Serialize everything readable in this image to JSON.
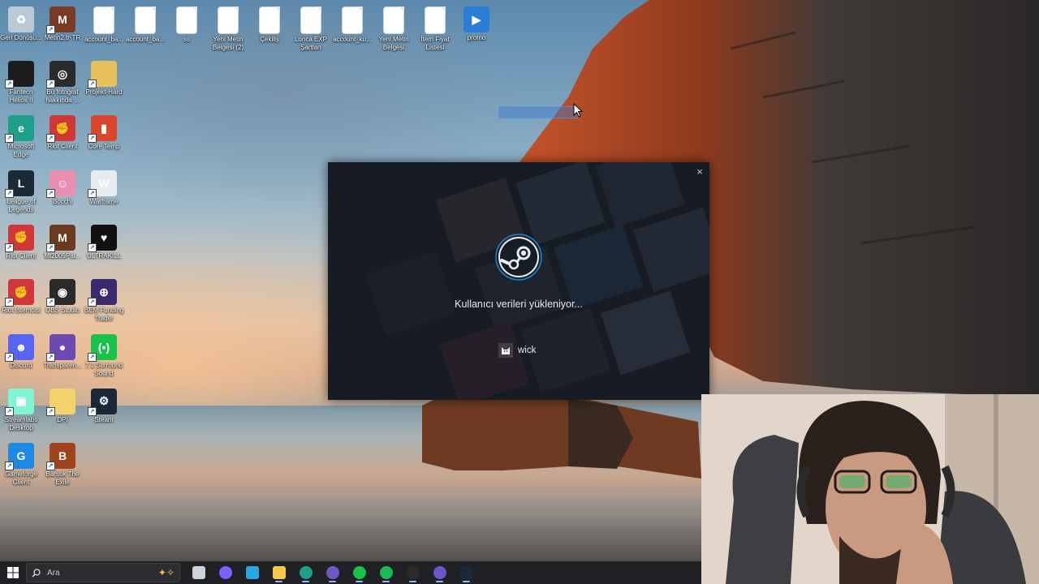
{
  "desktop": {
    "icons": [
      {
        "label": "Geri Dönüşü...",
        "icon": "recycle-bin-icon",
        "color": "#b9c9d6",
        "glyph": "♻"
      },
      {
        "label": "Metin2.tr-TR",
        "icon": "metin2-icon",
        "color": "#7a3b22",
        "glyph": "M"
      },
      {
        "label": "account_ba...",
        "icon": "document-icon",
        "color": "#ffffff",
        "glyph": ""
      },
      {
        "label": "account_ba...",
        "icon": "document-icon",
        "color": "#ffffff",
        "glyph": ""
      },
      {
        "label": "ss",
        "icon": "text-file-icon",
        "color": "#ffffff",
        "glyph": ""
      },
      {
        "label": "Yeni Metin Belgesi (2)",
        "icon": "text-file-icon",
        "color": "#ffffff",
        "glyph": ""
      },
      {
        "label": "Çekiliş",
        "icon": "document-icon",
        "color": "#ffffff",
        "glyph": ""
      },
      {
        "label": "Lonca EXP Şartları",
        "icon": "document-icon",
        "color": "#ffffff",
        "glyph": ""
      },
      {
        "label": "account_ku...",
        "icon": "document-icon",
        "color": "#ffffff",
        "glyph": ""
      },
      {
        "label": "Yeni Metin Belgesi",
        "icon": "text-file-icon",
        "color": "#ffffff",
        "glyph": ""
      },
      {
        "label": "İtem Fiyat Listesi",
        "icon": "text-file-icon",
        "color": "#ffffff",
        "glyph": ""
      },
      {
        "label": "promo",
        "icon": "video-file-icon",
        "color": "#2a7fd4",
        "glyph": "▶"
      },
      {
        "label": "Fantech Helios II",
        "icon": "mouse-icon",
        "color": "#1c1c1c",
        "glyph": ""
      },
      {
        "label": "Bu fotoğraf hakkında ...",
        "icon": "camera-aperture-icon",
        "color": "#2b2b2b",
        "glyph": "◎"
      },
      {
        "label": "Projekt-Hard",
        "icon": "zip-folder-icon",
        "color": "#e8c15a",
        "glyph": ""
      },
      {
        "label": "Microsoft Edge",
        "icon": "edge-icon",
        "color": "#1f9e8a",
        "glyph": "e"
      },
      {
        "label": "Riot Client",
        "icon": "riot-icon",
        "color": "#d13639",
        "glyph": "✊"
      },
      {
        "label": "Core Temp",
        "icon": "core-temp-icon",
        "color": "#d9482b",
        "glyph": "▮"
      },
      {
        "label": "League of Legends",
        "icon": "league-icon",
        "color": "#1b2a36",
        "glyph": "L"
      },
      {
        "label": "Bocchi",
        "icon": "anime-character-icon",
        "color": "#e88fb2",
        "glyph": "☺"
      },
      {
        "label": "Warframe",
        "icon": "warframe-icon",
        "color": "#e9ecef",
        "glyph": "W"
      },
      {
        "label": "Riot Client",
        "icon": "riot-icon",
        "color": "#d13639",
        "glyph": "✊"
      },
      {
        "label": "Mt2009Pat...",
        "icon": "metin2-icon",
        "color": "#6b3a1f",
        "glyph": "M"
      },
      {
        "label": "ULTRAKILL",
        "icon": "ultrakill-icon",
        "color": "#111111",
        "glyph": "♥"
      },
      {
        "label": "Riot İstemcisi",
        "icon": "riot-icon",
        "color": "#d13639",
        "glyph": "✊"
      },
      {
        "label": "OBS Studio",
        "icon": "obs-icon",
        "color": "#2a2a2a",
        "glyph": "◉"
      },
      {
        "label": "BEM Funding Trader",
        "icon": "globe-icon",
        "color": "#3b2a6e",
        "glyph": "⊕"
      },
      {
        "label": "Discord",
        "icon": "discord-icon",
        "color": "#5865f2",
        "glyph": "☻"
      },
      {
        "label": "Transparen...",
        "icon": "transparent-app-icon",
        "color": "#6d4ab2",
        "glyph": "●"
      },
      {
        "label": "7.1 Surround Sound",
        "icon": "surround-sound-icon",
        "color": "#19c24a",
        "glyph": "(•)"
      },
      {
        "label": "Streamlabs Desktop",
        "icon": "streamlabs-icon",
        "color": "#80f5d2",
        "glyph": "▣"
      },
      {
        "label": "DPI",
        "icon": "folder-icon",
        "color": "#f3d26b",
        "glyph": ""
      },
      {
        "label": "Steam",
        "icon": "steam-icon",
        "color": "#1b2838",
        "glyph": "⚙"
      },
      {
        "label": "Gameforge Client",
        "icon": "gameforge-icon",
        "color": "#1e88e5",
        "glyph": "G"
      },
      {
        "label": "Barsuk The Exile",
        "icon": "barsuk-icon",
        "color": "#a0431a",
        "glyph": "B"
      }
    ]
  },
  "steam_dialog": {
    "message": "Kullanıcı verileri yükleniyor...",
    "username": "wick",
    "close_glyph": "×",
    "accent": "#1a9fff"
  },
  "taskbar": {
    "search_placeholder": "Ara",
    "apps": [
      {
        "name": "task-view-icon",
        "color": "#cfd3d8"
      },
      {
        "name": "copilot-icon",
        "color": "#7b61ff"
      },
      {
        "name": "microsoft-store-icon",
        "color": "#2aa7e0"
      },
      {
        "name": "file-explorer-icon",
        "color": "#f2c94c"
      },
      {
        "name": "edge-icon",
        "color": "#1f9e8a"
      },
      {
        "name": "obs-record-icon",
        "color": "#6f59c7"
      },
      {
        "name": "sound-app-icon",
        "color": "#19c24a"
      },
      {
        "name": "spotify-icon",
        "color": "#1db954"
      },
      {
        "name": "aperture-app-icon",
        "color": "#2b2b2b"
      },
      {
        "name": "discord-icon",
        "color": "#6b57c8"
      },
      {
        "name": "steam-icon",
        "color": "#1b2838"
      }
    ]
  }
}
